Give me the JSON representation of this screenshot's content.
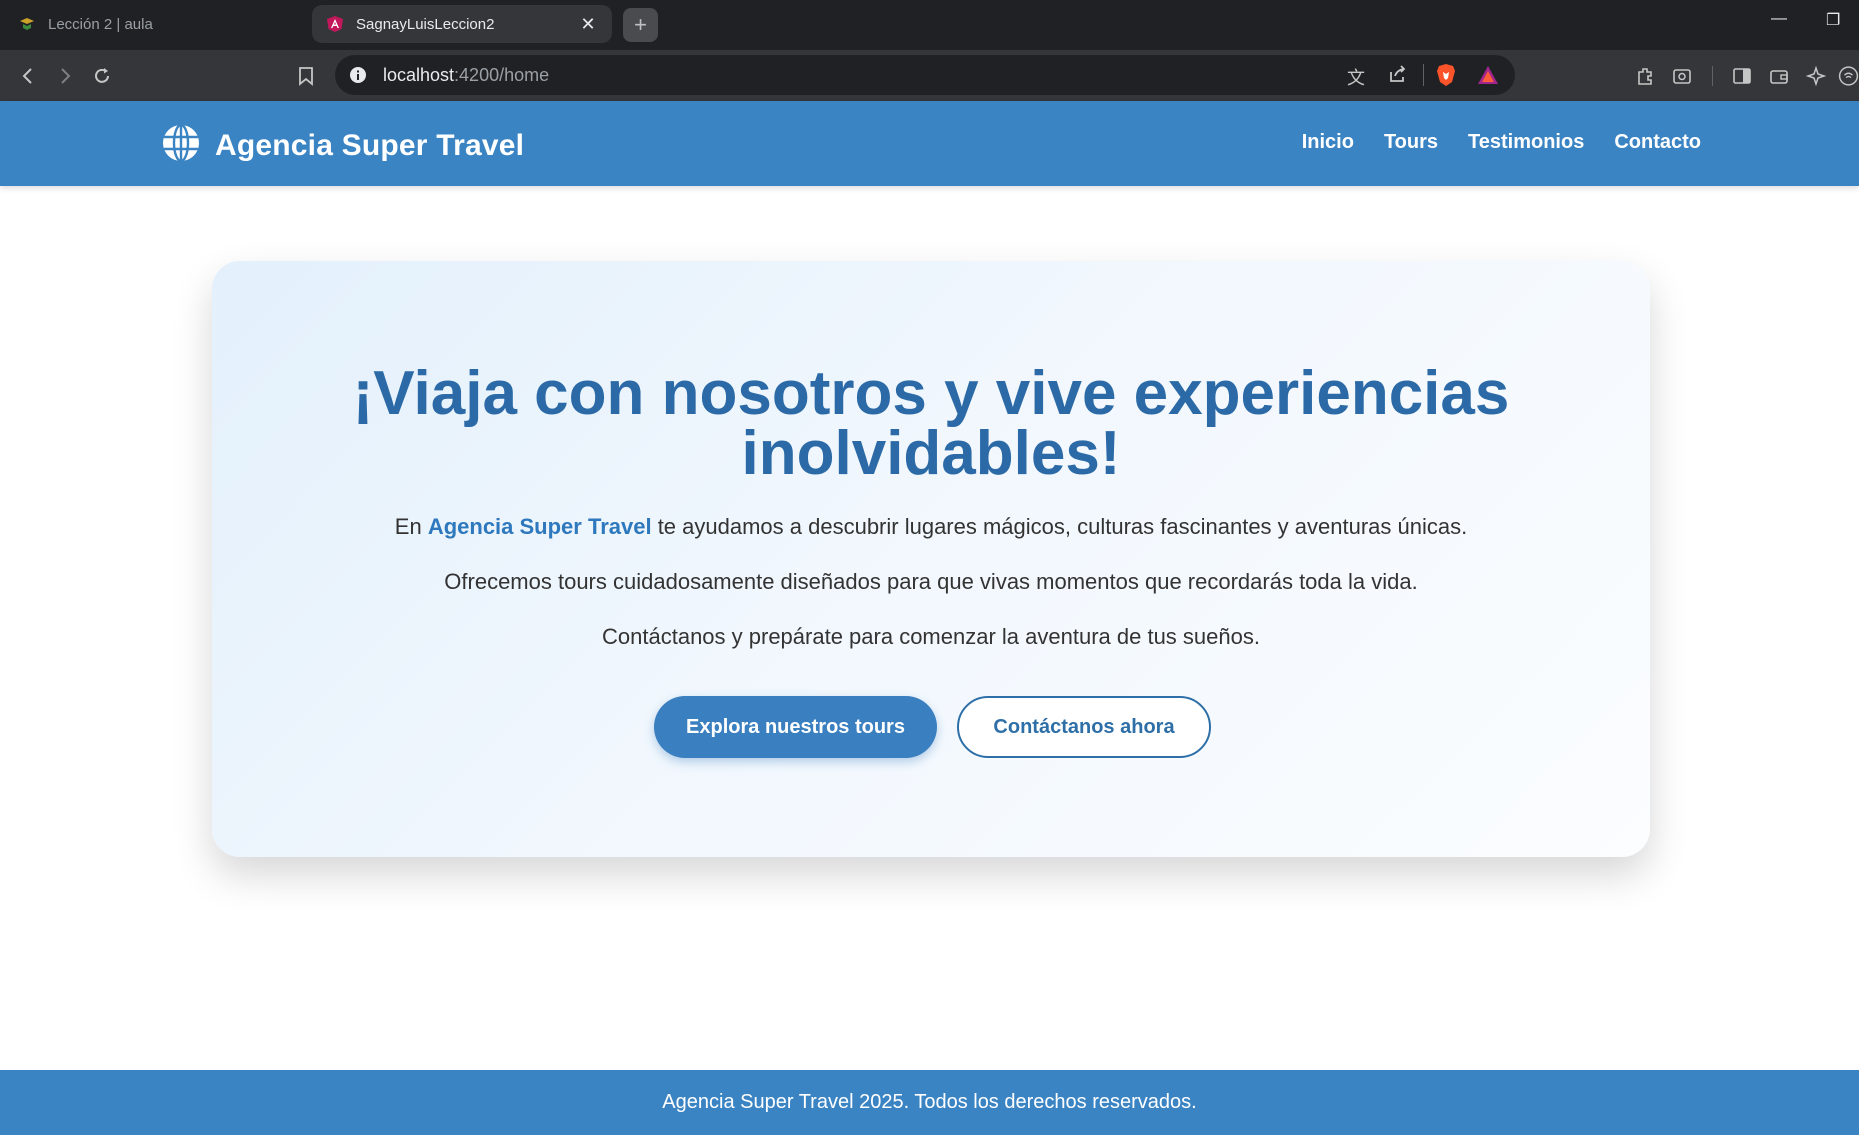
{
  "browser": {
    "tabs": [
      {
        "title": "Lección 2 | aula",
        "active": false
      },
      {
        "title": "SagnayLuisLeccion2",
        "active": true
      }
    ],
    "new_tab_label": "+",
    "url_host": "localhost",
    "url_path": ":4200/home",
    "colors": {
      "tabstrip": "#202124",
      "toolbar": "#35363a"
    }
  },
  "navbar": {
    "brand": "Agencia Super Travel",
    "links": [
      "Inicio",
      "Tours",
      "Testimonios",
      "Contacto"
    ],
    "color": "#3a84c4"
  },
  "hero": {
    "title": "¡Viaja con nosotros y vive experiencias inolvidables!",
    "p1_before": "En ",
    "p1_highlight": "Agencia Super Travel",
    "p1_after": " te ayudamos a descubrir lugares mágicos, culturas fascinantes y aventuras únicas.",
    "p2": "Ofrecemos tours cuidadosamente diseñados para que vivas momentos que recordarás toda la vida.",
    "p3": "Contáctanos y prepárate para comenzar la aventura de tus sueños.",
    "primary_button": "Explora nuestros tours",
    "secondary_button": "Contáctanos ahora",
    "title_color": "#2b6aa6"
  },
  "footer": {
    "text": "Agencia Super Travel 2025. Todos los derechos reservados."
  }
}
